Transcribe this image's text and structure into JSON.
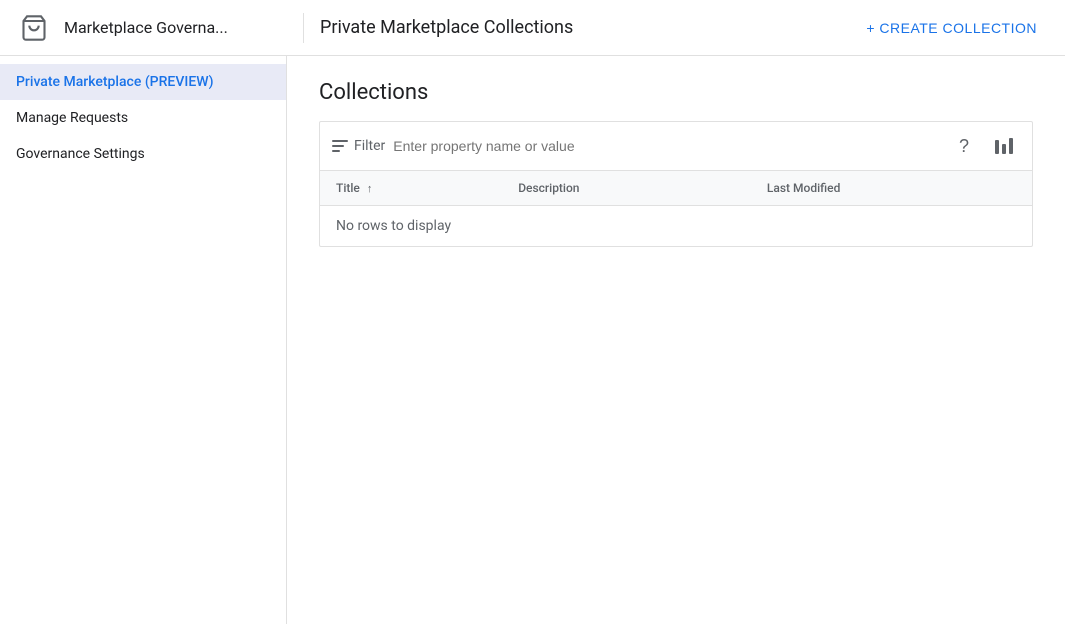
{
  "header": {
    "app_title": "Marketplace Governa...",
    "page_title": "Private Marketplace Collections",
    "create_button_label": "+ CREATE COLLECTION"
  },
  "sidebar": {
    "items": [
      {
        "id": "private-marketplace",
        "label": "Private Marketplace (PREVIEW)",
        "active": true
      },
      {
        "id": "manage-requests",
        "label": "Manage Requests",
        "active": false
      },
      {
        "id": "governance-settings",
        "label": "Governance Settings",
        "active": false
      }
    ]
  },
  "content": {
    "section_title": "Collections",
    "filter": {
      "label": "Filter",
      "placeholder": "Enter property name or value"
    },
    "table": {
      "columns": [
        {
          "id": "title",
          "label": "Title",
          "sortable": true,
          "sorted": true,
          "sort_direction": "asc"
        },
        {
          "id": "description",
          "label": "Description",
          "sortable": false
        },
        {
          "id": "last_modified",
          "label": "Last Modified",
          "sortable": false
        }
      ],
      "empty_message": "No rows to display",
      "rows": []
    }
  },
  "icons": {
    "filter": "filter-icon",
    "help": "help-icon",
    "columns": "columns-icon",
    "cart": "cart-icon"
  }
}
